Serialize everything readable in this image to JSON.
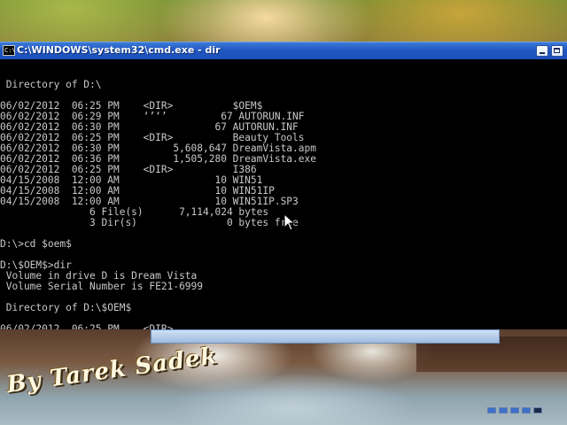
{
  "window": {
    "title": "C:\\WINDOWS\\system32\\cmd.exe - dir",
    "icon": "cmd-icon",
    "buttons": [
      "minimize-icon",
      "maximize-icon"
    ]
  },
  "console": {
    "lines": [
      "",
      " Directory of D:\\",
      "",
      "06/02/2012  06:25 PM    <DIR>          $OEM$",
      "06/02/2012  06:29 PM    ‘’‘’         67 AUTORUN.INF",
      "06/02/2012  06:30 PM                67 AUTORUN.INF",
      "06/02/2012  06:25 PM    <DIR>          Beauty Tools",
      "06/02/2012  06:30 PM         5,608,647 DreamVista.apm",
      "06/02/2012  06:36 PM         1,505,280 DreamVista.exe",
      "06/02/2012  06:25 PM    <DIR>          I386",
      "04/15/2008  12:00 AM                10 WIN51",
      "04/15/2008  12:00 AM                10 WIN51IP",
      "04/15/2008  12:00 AM                10 WIN51IP.SP3",
      "               6 File(s)      7,114,024 bytes",
      "               3 Dir(s)               0 bytes free",
      "",
      "D:\\>cd $oem$",
      "",
      "D:\\$OEM$>dir",
      " Volume in drive D is Dream Vista",
      " Volume Serial Number is FE21-6999",
      "",
      " Directory of D:\\$OEM$",
      "",
      "06/02/2012  06:25 PM    <DIR>          ."
    ]
  },
  "wallpaper": {
    "watermark": "By Tarek Sadek"
  },
  "colors": {
    "title_bar": "#2258c4",
    "console_bg": "#000000",
    "console_fg": "#c8c8c8"
  }
}
